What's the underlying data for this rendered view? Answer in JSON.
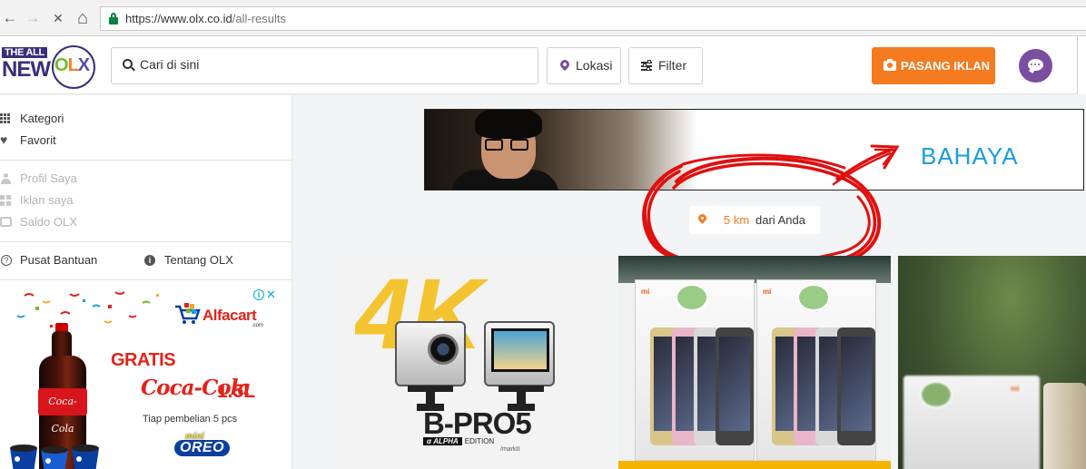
{
  "browser": {
    "back_icon": "←",
    "forward_icon": "→",
    "stop_icon": "✕",
    "home_icon": "⌂",
    "url_host": "https://www.olx.co.id",
    "url_path": "/all-results"
  },
  "header": {
    "logo_top": "THE ALL",
    "logo_new": "NEW",
    "logo_o": "O",
    "logo_l": "L",
    "logo_x": "X",
    "search_placeholder": "Cari di sini",
    "location_label": "Lokasi",
    "filter_label": "Filter",
    "post_ad_label": "PASANG IKLAN"
  },
  "sidebar": {
    "primary": [
      {
        "label": "Kategori",
        "icon": "grid-icon"
      },
      {
        "label": "Favorit",
        "icon": "heart-icon"
      }
    ],
    "account": [
      {
        "label": "Profil Saya",
        "icon": "user-icon"
      },
      {
        "label": "Iklan saya",
        "icon": "ads-icon"
      },
      {
        "label": "Saldo OLX",
        "icon": "wallet-icon"
      }
    ],
    "help_label": "Pusat Bantuan",
    "about_label": "Tentang OLX"
  },
  "side_ad": {
    "brand": "Alfacart",
    "brand_sub": ".com",
    "gratis": "GRATIS",
    "product": "Coca-Cola",
    "bottle_label": "Coca-Cola",
    "size": "1.5L",
    "terms": "Tiap pembelian 5 pcs",
    "oreo_mini": "mini",
    "oreo_brand": "OREO",
    "adchoices_i": "i",
    "adchoices_x": "✕"
  },
  "banner": {
    "headline": "BAHAYA"
  },
  "distance": {
    "value": "5 km",
    "suffix": "dari Anda"
  },
  "listings": [
    {
      "product": "B-PRO",
      "product_num": "5",
      "badge_prefix": "α",
      "badge": "ALPHA",
      "edition": "EDITION",
      "model": "/markII",
      "banner_text": "4K"
    },
    {
      "brand": "mi",
      "sticker": "ORIGINAL"
    },
    {
      "brand": "mi"
    }
  ],
  "colors": {
    "accent_orange": "#f47b20",
    "brand_purple": "#7b4fa0",
    "annotation_red": "#e01010",
    "banner_blue": "#1a9ddb"
  }
}
